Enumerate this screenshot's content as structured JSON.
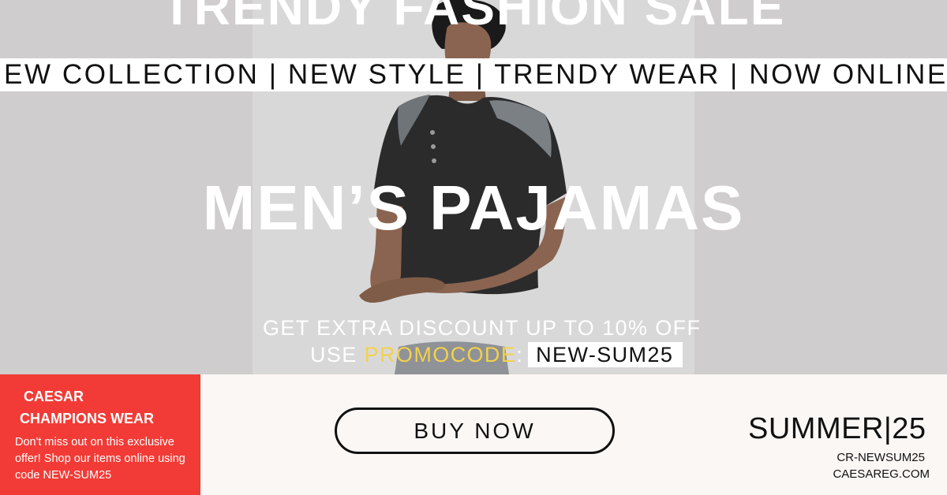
{
  "hero": {
    "headline_top": "TRENDY FASHION SALE",
    "marquee": "EW COLLECTION | NEW STYLE | TRENDY WEAR | NOW ONLINE",
    "title": "MEN’S PAJAMAS",
    "discount_line": "GET EXTRA DISCOUNT UP TO 10% OFF",
    "promo_prefix": "USE ",
    "promo_word": "PROMOCODE",
    "promo_colon": ":",
    "promo_code": "NEW-SUM25"
  },
  "footer": {
    "brand_line1": "CAESAR",
    "brand_line2": "CHAMPIONS WEAR",
    "offer_text": "Don't miss out on this exclusive offer! Shop our items online using code NEW-SUM25",
    "buy_label": "BUY NOW",
    "season": "SUMMER|25",
    "code": "CR-NEWSUM25",
    "site": "CAESAREG.COM"
  },
  "colors": {
    "accent_red": "#f23b36",
    "promo_yellow": "#f2d24a",
    "background_photo": "#cfcdce",
    "strip": "#fbf7f5"
  },
  "icons": [
    "model-photo"
  ]
}
